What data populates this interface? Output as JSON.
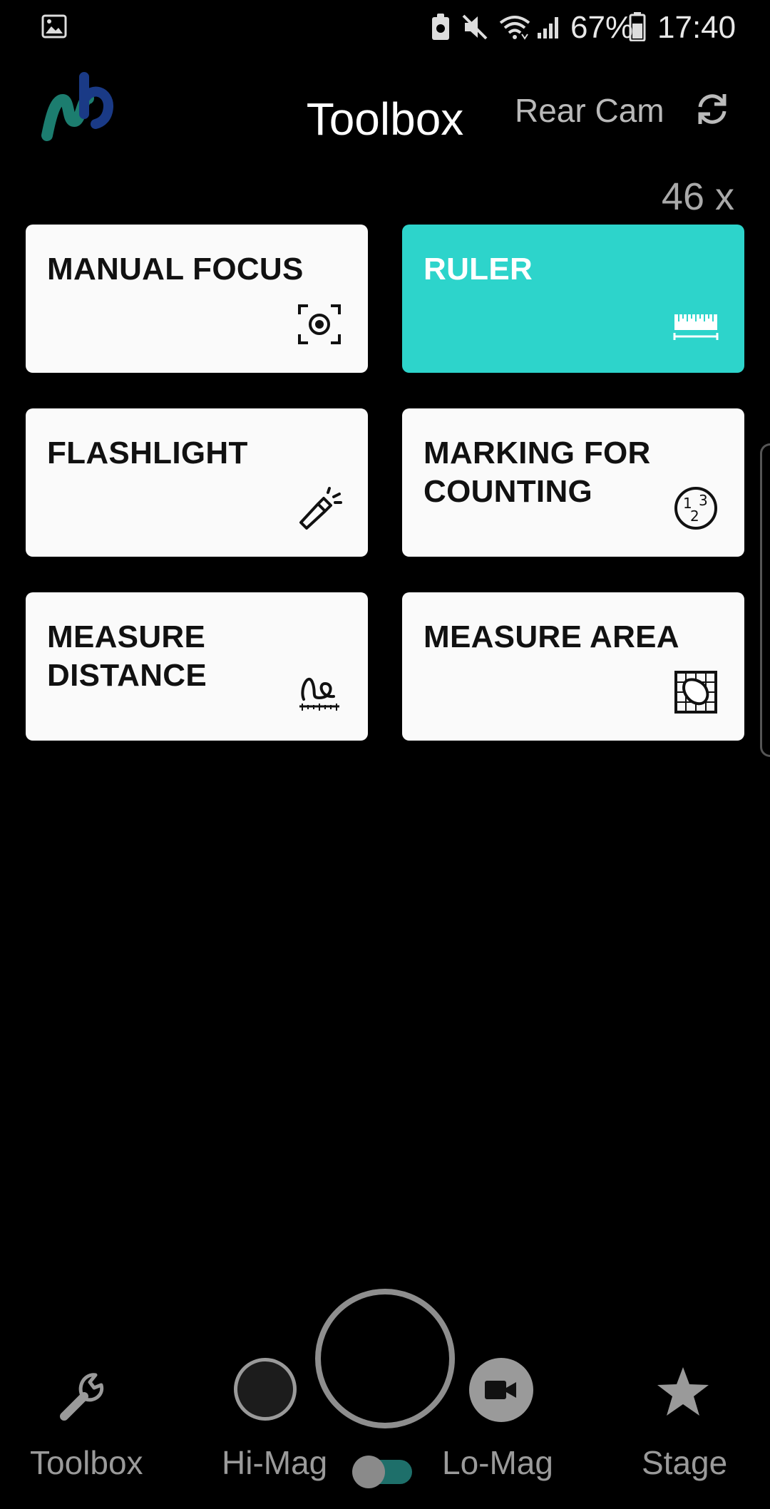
{
  "status_bar": {
    "battery_percent": "67%",
    "time": "17:40",
    "icons": [
      "gallery-icon",
      "app-notification-icon",
      "mute-icon",
      "wifi-icon",
      "signal-icon",
      "battery-icon"
    ]
  },
  "header": {
    "logo": "app-logo",
    "title": "Toolbox",
    "camera_label": "Rear Cam",
    "switch_icon": "camera-switch-icon",
    "magnification": "46 x"
  },
  "tiles": [
    {
      "label": "MANUAL FOCUS",
      "icon": "focus-target-icon",
      "active": false
    },
    {
      "label": "RULER",
      "icon": "ruler-icon",
      "active": true
    },
    {
      "label": "FLASHLIGHT",
      "icon": "flashlight-icon",
      "active": false
    },
    {
      "label": "MARKING FOR COUNTING",
      "icon": "counting-numbers-icon",
      "active": false
    },
    {
      "label": "MEASURE DISTANCE",
      "icon": "measure-distance-icon",
      "active": false
    },
    {
      "label": "MEASURE AREA",
      "icon": "measure-area-icon",
      "active": false
    }
  ],
  "colors": {
    "accent": "#2dd4cb",
    "tile_bg": "#fafafa",
    "background": "#000000",
    "nav_text": "#9a9a9a"
  },
  "bottom_bar": {
    "toolbox_label": "Toolbox",
    "himag_label": "Hi-Mag",
    "lomag_label": "Lo-Mag",
    "stage_label": "Stage",
    "mag_toggle_state": "Lo-Mag"
  }
}
